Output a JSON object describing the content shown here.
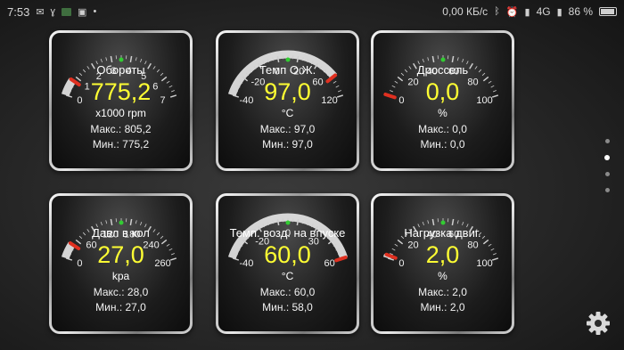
{
  "status_bar": {
    "time": "7:53",
    "speed": "0,00 КБ/с",
    "network": "4G",
    "battery": "86 %"
  },
  "gauges": [
    {
      "id": "rpm",
      "title": "Обороты",
      "value": "775,2",
      "unit": "x1000 rpm",
      "max": "Макс.: 805,2",
      "min": "Мин.: 775,2",
      "ticks": [
        "0",
        "1",
        "2",
        "3",
        "4",
        "5",
        "6",
        "7"
      ],
      "range": [
        0,
        7
      ],
      "reading": 0.78
    },
    {
      "id": "coolant",
      "title": "Темп О.Ж.",
      "value": "97,0",
      "unit": "°C",
      "max": "Макс.: 97,0",
      "min": "Мин.: 97,0",
      "ticks": [
        "-40",
        "-20",
        "0",
        "20",
        "60",
        "120"
      ],
      "range": [
        -40,
        120
      ],
      "reading": 97
    },
    {
      "id": "throttle",
      "title": "Дроссель",
      "value": "0,0",
      "unit": "%",
      "max": "Макс.: 0,0",
      "min": "Мин.: 0,0",
      "ticks": [
        "0",
        "20",
        "40",
        "60",
        "80",
        "100"
      ],
      "range": [
        0,
        100
      ],
      "reading": 0
    },
    {
      "id": "map",
      "title": "Давл в кол",
      "value": "27,0",
      "unit": "kpa",
      "max": "Макс.: 28,0",
      "min": "Мин.: 27,0",
      "ticks": [
        "0",
        "60",
        "120",
        "180",
        "240",
        "260"
      ],
      "range": [
        0,
        260
      ],
      "reading": 27
    },
    {
      "id": "iat",
      "title": "Темп. возд. на впуске",
      "value": "60,0",
      "unit": "°C",
      "max": "Макс.: 60,0",
      "min": "Мин.: 58,0",
      "ticks": [
        "-40",
        "-20",
        "0",
        "30",
        "60"
      ],
      "range": [
        -40,
        60
      ],
      "reading": 60
    },
    {
      "id": "load",
      "title": "Нагрузка двиг.",
      "value": "2,0",
      "unit": "%",
      "max": "Макс.: 2,0",
      "min": "Мин.: 2,0",
      "ticks": [
        "0",
        "20",
        "40",
        "60",
        "80",
        "100"
      ],
      "range": [
        0,
        100
      ],
      "reading": 2
    }
  ],
  "colors": {
    "value": "#ffff33",
    "marker_green": "#33cc33",
    "pointer_red": "#e03020"
  },
  "pager": {
    "count": 4,
    "active": 2
  },
  "icons": {
    "settings": "gear-icon"
  }
}
